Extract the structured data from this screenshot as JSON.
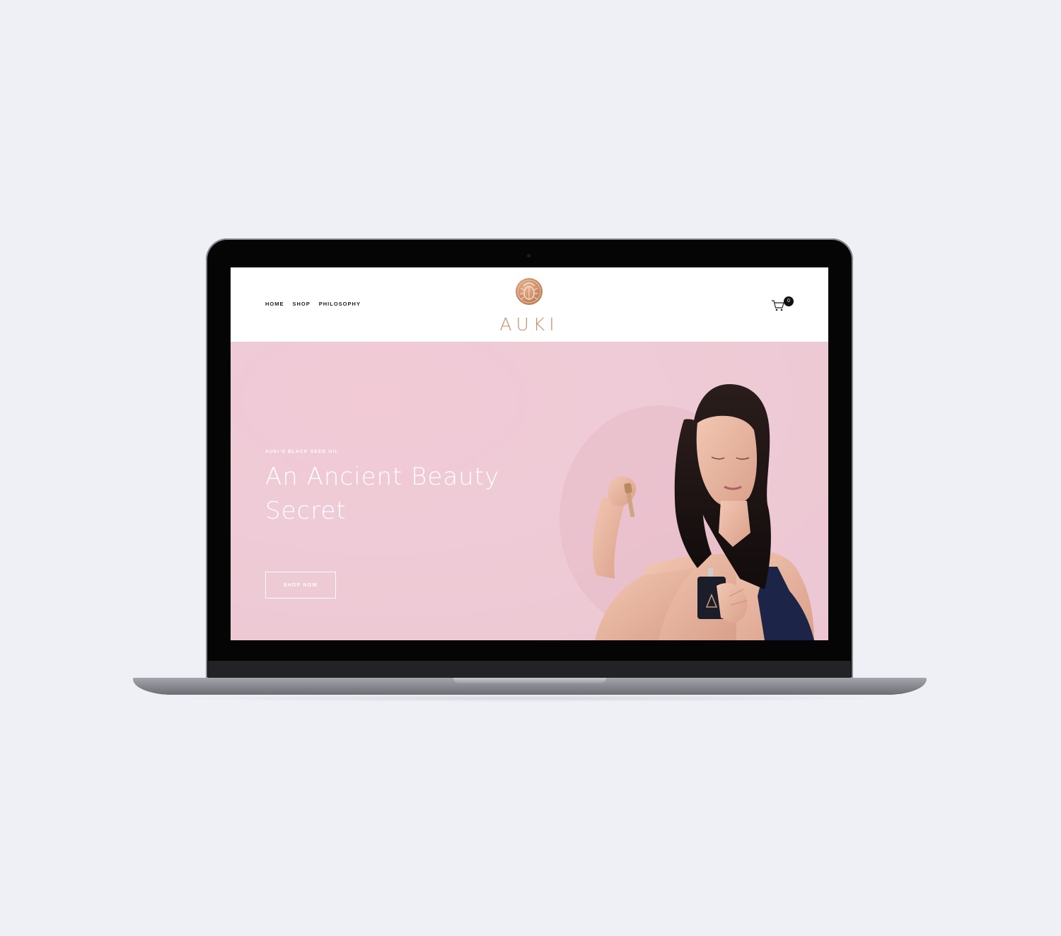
{
  "site": {
    "nav": [
      {
        "label": "HOME"
      },
      {
        "label": "SHOP"
      },
      {
        "label": "PHILOSOPHY"
      }
    ],
    "logo_text": "AUKI",
    "logo_icon": "scarab-emblem-icon",
    "cart_icon": "shopping-cart-icon",
    "cart_count": "0"
  },
  "hero": {
    "eyebrow": "AUKI'S BLACK SEED OIL",
    "title_line1": "An Ancient Beauty",
    "title_line2": "Secret",
    "cta_label": "SHOP NOW",
    "photo": "woman-with-dropper-bottle"
  },
  "colors": {
    "background": "#efeff6",
    "hero_pink": "#eecbd6",
    "brand_copper": "#c98d6b",
    "header_white": "#ffffff"
  }
}
